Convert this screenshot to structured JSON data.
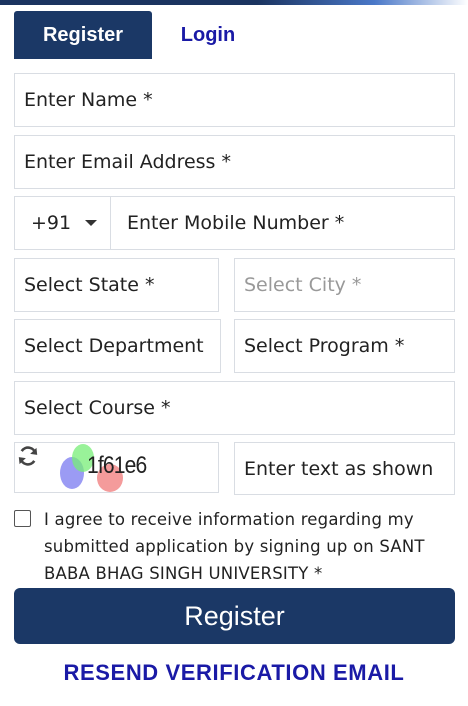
{
  "tabs": {
    "register_label": "Register",
    "login_label": "Login"
  },
  "form": {
    "name_placeholder": "Enter Name *",
    "email_placeholder": "Enter Email Address *",
    "country_code": "+91",
    "mobile_placeholder": "Enter Mobile Number *",
    "state_placeholder": "Select State *",
    "city_placeholder": "Select City *",
    "department_placeholder": "Select Department",
    "program_placeholder": "Select Program *",
    "course_placeholder": "Select Course *",
    "captcha_text": "1f61e6",
    "captcha_input_placeholder": "Enter text as shown",
    "consent_text": "I agree to receive information regarding my submitted application by signing up on SANT BABA BHAG SINGH UNIVERSITY *",
    "submit_label": "Register",
    "resend_label": "RESEND VERIFICATION EMAIL"
  },
  "icons": {
    "dropdown": "chevron-down-icon",
    "refresh": "refresh-icon"
  },
  "colors": {
    "primary": "#1b3866",
    "link": "#1a1aa6",
    "border": "#d9dde3"
  }
}
